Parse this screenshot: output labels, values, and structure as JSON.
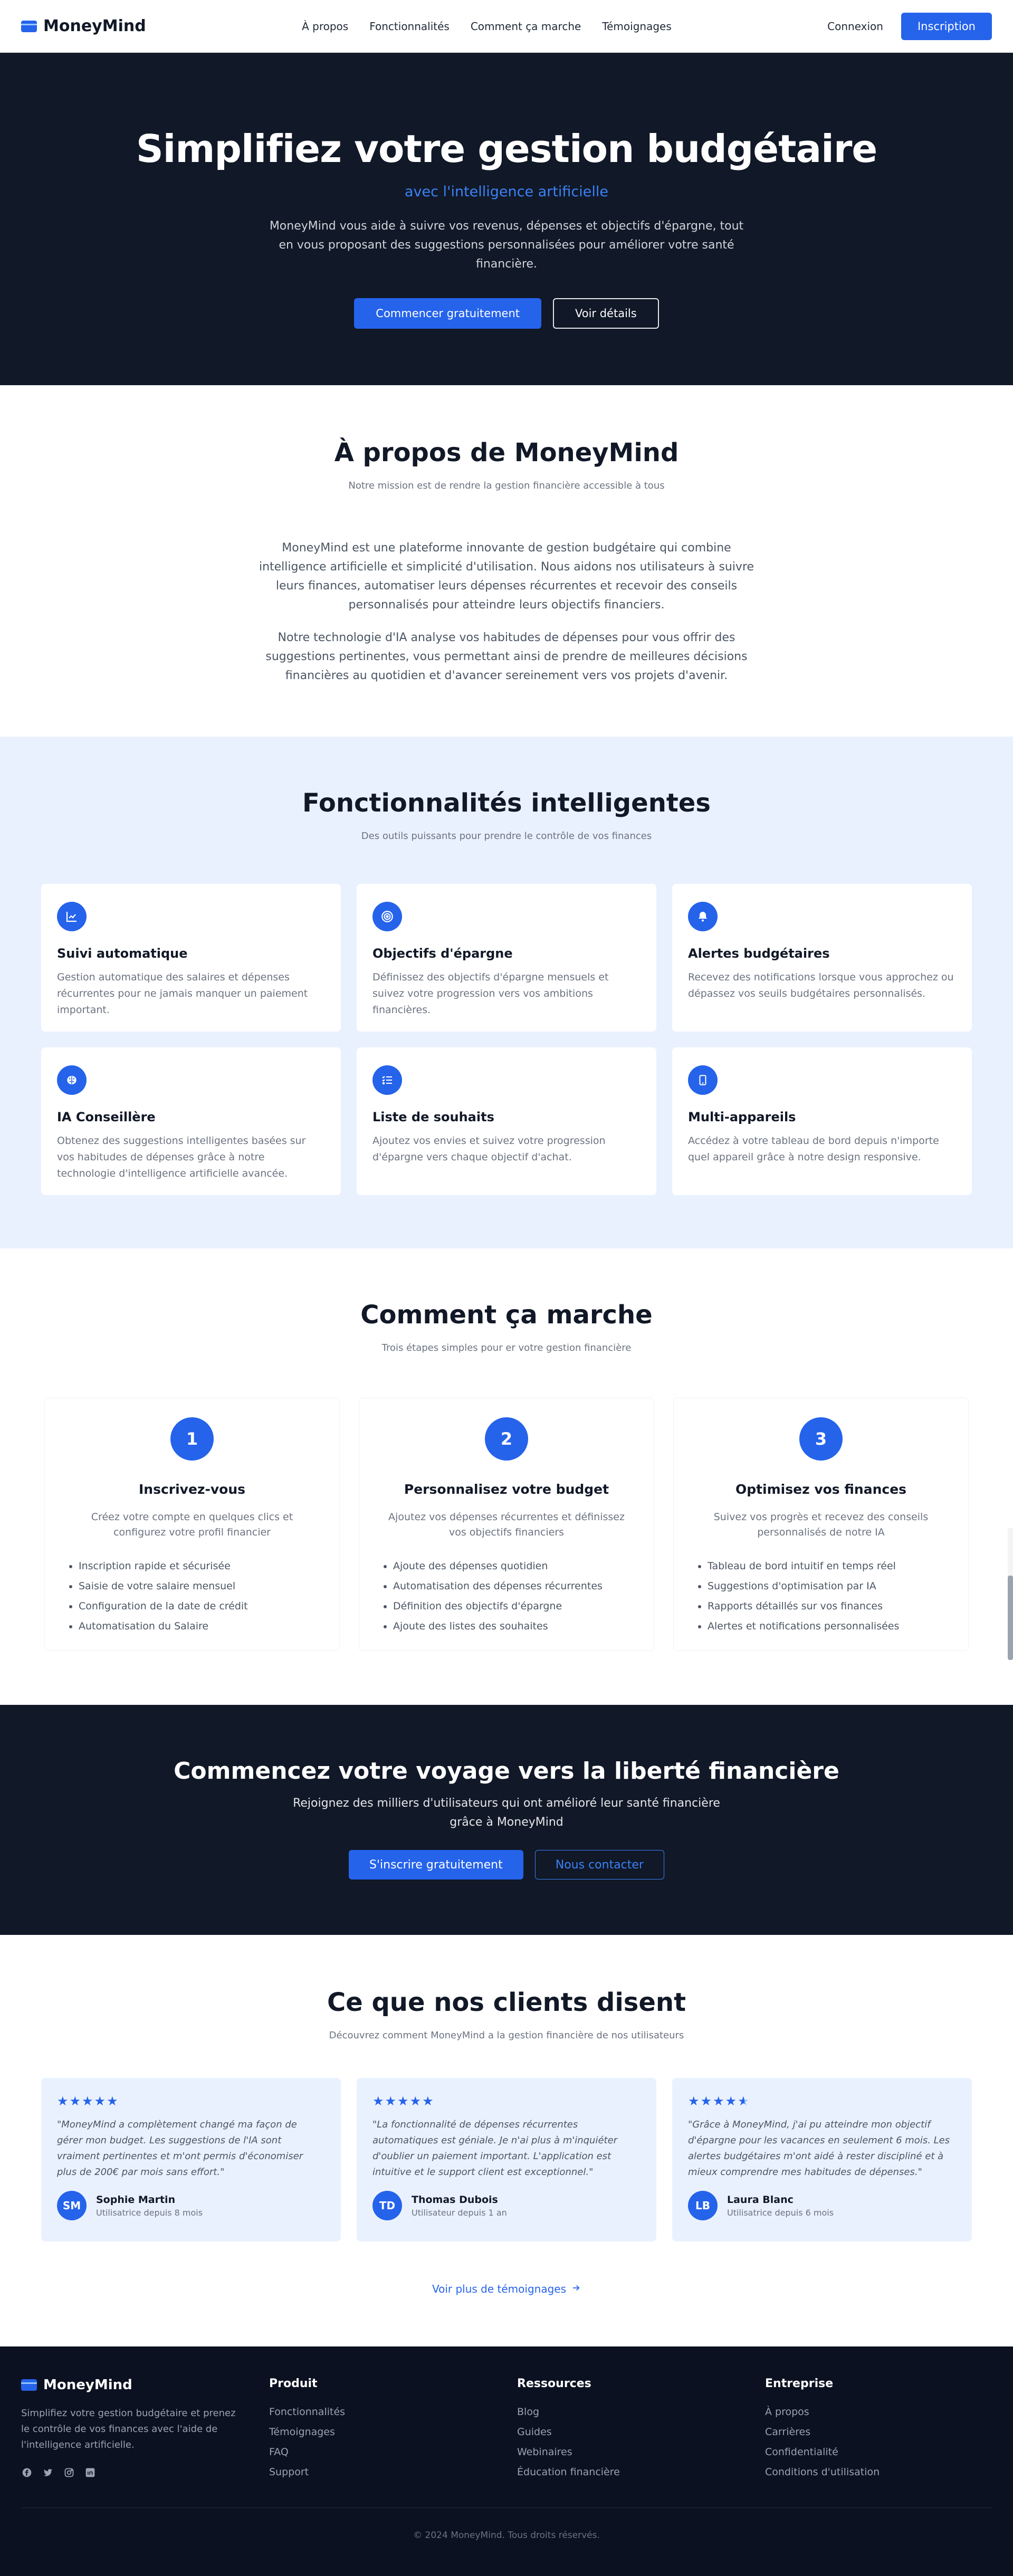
{
  "nav": {
    "brand": "MoneyMind",
    "links": [
      "À propos",
      "Fonctionnalités",
      "Comment ça marche",
      "Témoignages"
    ],
    "login": "Connexion",
    "signup": "Inscription"
  },
  "hero": {
    "title": "Simplifiez votre gestion budgétaire",
    "subtitle": "avec l'intelligence artificielle",
    "description": "MoneyMind vous aide à suivre vos revenus, dépenses et objectifs d'épargne, tout en vous proposant des suggestions personnalisées pour améliorer votre santé financière.",
    "cta_primary": "Commencer gratuitement",
    "cta_secondary": "Voir détails"
  },
  "about": {
    "title": "À propos de MoneyMind",
    "subtitle": "Notre mission est de rendre la gestion financière accessible à tous",
    "p1": "MoneyMind est une plateforme innovante de gestion budgétaire qui combine intelligence artificielle et simplicité d'utilisation. Nous aidons nos utilisateurs à suivre leurs finances, automatiser leurs dépenses récurrentes et recevoir des conseils personnalisés pour atteindre leurs objectifs financiers.",
    "p2": "Notre technologie d'IA analyse vos habitudes de dépenses pour vous offrir des suggestions pertinentes, vous permettant ainsi de prendre de meilleures décisions financières au quotidien et d'avancer sereinement vers vos projets d'avenir."
  },
  "features": {
    "title": "Fonctionnalités intelligentes",
    "subtitle": "Des outils puissants pour prendre le contrôle de vos finances",
    "items": [
      {
        "icon": "chart-line-icon",
        "title": "Suivi automatique",
        "desc": "Gestion automatique des salaires et dépenses récurrentes pour ne jamais manquer un paiement important."
      },
      {
        "icon": "target-icon",
        "title": "Objectifs d'épargne",
        "desc": "Définissez des objectifs d'épargne mensuels et suivez votre progression vers vos ambitions financières."
      },
      {
        "icon": "bell-icon",
        "title": "Alertes budgétaires",
        "desc": "Recevez des notifications lorsque vous approchez ou dépassez vos seuils budgétaires personnalisés."
      },
      {
        "icon": "brain-icon",
        "title": "IA Conseillère",
        "desc": "Obtenez des suggestions intelligentes basées sur vos habitudes de dépenses grâce à notre technologie d'intelligence artificielle avancée."
      },
      {
        "icon": "list-check-icon",
        "title": "Liste de souhaits",
        "desc": "Ajoutez vos envies et suivez votre progression d'épargne vers chaque objectif d'achat."
      },
      {
        "icon": "mobile-icon",
        "title": "Multi-appareils",
        "desc": "Accédez à votre tableau de bord depuis n'importe quel appareil grâce à notre design responsive."
      }
    ]
  },
  "how": {
    "title": "Comment ça marche",
    "subtitle": "Trois étapes simples pour er votre gestion financière",
    "steps": [
      {
        "num": "1",
        "title": "Inscrivez-vous",
        "desc": "Créez votre compte en quelques clics et configurez votre profil financier",
        "bullets": [
          "Inscription rapide et sécurisée",
          "Saisie de votre salaire mensuel",
          "Configuration de la date de crédit",
          "Automatisation du Salaire"
        ]
      },
      {
        "num": "2",
        "title": "Personnalisez votre budget",
        "desc": "Ajoutez vos dépenses récurrentes et définissez vos objectifs financiers",
        "bullets": [
          "Ajoute des dépenses quotidien",
          "Automatisation des dépenses récurrentes",
          "Définition des objectifs d'épargne",
          "Ajoute des listes des souhaites"
        ]
      },
      {
        "num": "3",
        "title": "Optimisez vos finances",
        "desc": "Suivez vos progrès et recevez des conseils personnalisés de notre IA",
        "bullets": [
          "Tableau de bord intuitif en temps réel",
          "Suggestions d'optimisation par IA",
          "Rapports détaillés sur vos finances",
          "Alertes et notifications personnalisées"
        ]
      }
    ]
  },
  "cta": {
    "title": "Commencez votre voyage vers la liberté financière",
    "text": "Rejoignez des milliers d'utilisateurs qui ont amélioré leur santé financière grâce à MoneyMind",
    "primary": "S'inscrire gratuitement",
    "secondary": "Nous contacter"
  },
  "testimonials": {
    "title": "Ce que nos clients disent",
    "subtitle": "Découvrez comment MoneyMind a la gestion financière de nos utilisateurs",
    "items": [
      {
        "stars": 5,
        "quote": "\"MoneyMind a complètement changé ma façon de gérer mon budget. Les suggestions de l'IA sont vraiment pertinentes et m'ont permis d'économiser plus de 200€ par mois sans effort.\"",
        "initials": "SM",
        "name": "Sophie Martin",
        "since": "Utilisatrice depuis 8 mois"
      },
      {
        "stars": 5,
        "quote": "\"La fonctionnalité de dépenses récurrentes automatiques est géniale. Je n'ai plus à m'inquiéter d'oublier un paiement important. L'application est intuitive et le support client est exceptionnel.\"",
        "initials": "TD",
        "name": "Thomas Dubois",
        "since": "Utilisateur depuis 1 an"
      },
      {
        "stars": 4.5,
        "quote": "\"Grâce à MoneyMind, j'ai pu atteindre mon objectif d'épargne pour les vacances en seulement 6 mois. Les alertes budgétaires m'ont aidé à rester discipliné et à mieux comprendre mes habitudes de dépenses.\"",
        "initials": "LB",
        "name": "Laura Blanc",
        "since": "Utilisatrice depuis 6 mois"
      }
    ],
    "more": "Voir plus de témoignages"
  },
  "footer": {
    "brand": "MoneyMind",
    "desc": "Simplifiez votre gestion budgétaire et prenez le contrôle de vos finances avec l'aide de l'intelligence artificielle.",
    "socials": [
      "facebook-icon",
      "twitter-icon",
      "instagram-icon",
      "linkedin-icon"
    ],
    "cols": [
      {
        "title": "Produit",
        "links": [
          "Fonctionnalités",
          "Témoignages",
          "FAQ",
          "Support"
        ]
      },
      {
        "title": "Ressources",
        "links": [
          "Blog",
          "Guides",
          "Webinaires",
          "Éducation financière"
        ]
      },
      {
        "title": "Entreprise",
        "links": [
          "À propos",
          "Carrières",
          "Confidentialité",
          "Conditions d'utilisation"
        ]
      }
    ],
    "copyright": "© 2024 MoneyMind. Tous droits réservés."
  },
  "colors": {
    "primary": "#2563eb",
    "dark": "#111827",
    "light_blue": "#eaf1fe",
    "footer": "#0b1120"
  }
}
